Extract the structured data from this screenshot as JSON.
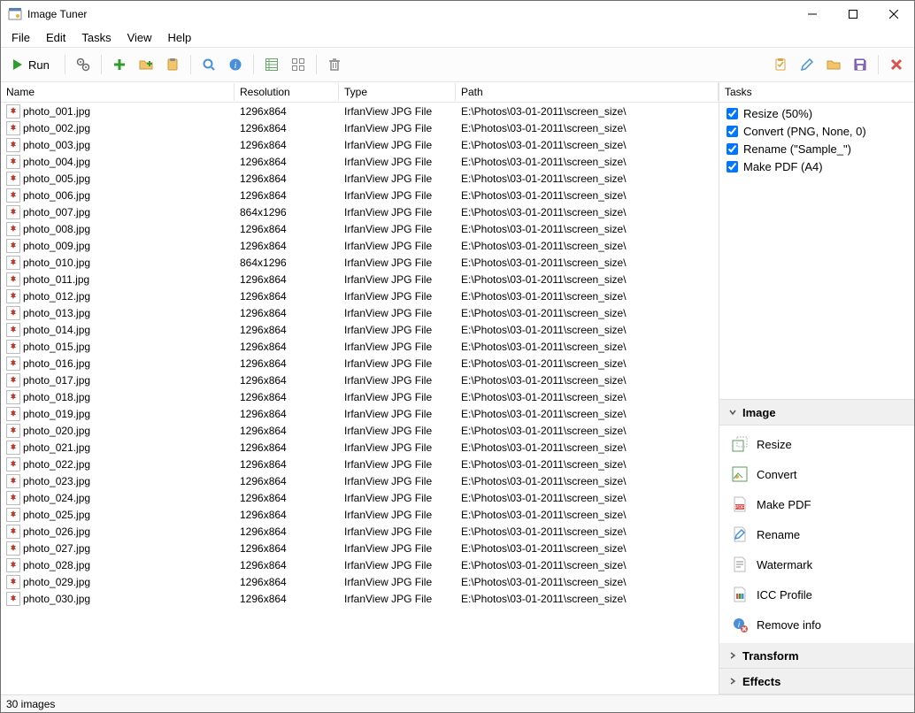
{
  "window": {
    "title": "Image Tuner"
  },
  "menu": [
    "File",
    "Edit",
    "Tasks",
    "View",
    "Help"
  ],
  "toolbar": {
    "run_label": "Run"
  },
  "columns": [
    "Name",
    "Resolution",
    "Type",
    "Path"
  ],
  "files": [
    {
      "name": "photo_001.jpg",
      "resolution": "1296x864",
      "type": "IrfanView JPG File",
      "path": "E:\\Photos\\03-01-2011\\screen_size\\"
    },
    {
      "name": "photo_002.jpg",
      "resolution": "1296x864",
      "type": "IrfanView JPG File",
      "path": "E:\\Photos\\03-01-2011\\screen_size\\"
    },
    {
      "name": "photo_003.jpg",
      "resolution": "1296x864",
      "type": "IrfanView JPG File",
      "path": "E:\\Photos\\03-01-2011\\screen_size\\"
    },
    {
      "name": "photo_004.jpg",
      "resolution": "1296x864",
      "type": "IrfanView JPG File",
      "path": "E:\\Photos\\03-01-2011\\screen_size\\"
    },
    {
      "name": "photo_005.jpg",
      "resolution": "1296x864",
      "type": "IrfanView JPG File",
      "path": "E:\\Photos\\03-01-2011\\screen_size\\"
    },
    {
      "name": "photo_006.jpg",
      "resolution": "1296x864",
      "type": "IrfanView JPG File",
      "path": "E:\\Photos\\03-01-2011\\screen_size\\"
    },
    {
      "name": "photo_007.jpg",
      "resolution": "864x1296",
      "type": "IrfanView JPG File",
      "path": "E:\\Photos\\03-01-2011\\screen_size\\"
    },
    {
      "name": "photo_008.jpg",
      "resolution": "1296x864",
      "type": "IrfanView JPG File",
      "path": "E:\\Photos\\03-01-2011\\screen_size\\"
    },
    {
      "name": "photo_009.jpg",
      "resolution": "1296x864",
      "type": "IrfanView JPG File",
      "path": "E:\\Photos\\03-01-2011\\screen_size\\"
    },
    {
      "name": "photo_010.jpg",
      "resolution": "864x1296",
      "type": "IrfanView JPG File",
      "path": "E:\\Photos\\03-01-2011\\screen_size\\"
    },
    {
      "name": "photo_011.jpg",
      "resolution": "1296x864",
      "type": "IrfanView JPG File",
      "path": "E:\\Photos\\03-01-2011\\screen_size\\"
    },
    {
      "name": "photo_012.jpg",
      "resolution": "1296x864",
      "type": "IrfanView JPG File",
      "path": "E:\\Photos\\03-01-2011\\screen_size\\"
    },
    {
      "name": "photo_013.jpg",
      "resolution": "1296x864",
      "type": "IrfanView JPG File",
      "path": "E:\\Photos\\03-01-2011\\screen_size\\"
    },
    {
      "name": "photo_014.jpg",
      "resolution": "1296x864",
      "type": "IrfanView JPG File",
      "path": "E:\\Photos\\03-01-2011\\screen_size\\"
    },
    {
      "name": "photo_015.jpg",
      "resolution": "1296x864",
      "type": "IrfanView JPG File",
      "path": "E:\\Photos\\03-01-2011\\screen_size\\"
    },
    {
      "name": "photo_016.jpg",
      "resolution": "1296x864",
      "type": "IrfanView JPG File",
      "path": "E:\\Photos\\03-01-2011\\screen_size\\"
    },
    {
      "name": "photo_017.jpg",
      "resolution": "1296x864",
      "type": "IrfanView JPG File",
      "path": "E:\\Photos\\03-01-2011\\screen_size\\"
    },
    {
      "name": "photo_018.jpg",
      "resolution": "1296x864",
      "type": "IrfanView JPG File",
      "path": "E:\\Photos\\03-01-2011\\screen_size\\"
    },
    {
      "name": "photo_019.jpg",
      "resolution": "1296x864",
      "type": "IrfanView JPG File",
      "path": "E:\\Photos\\03-01-2011\\screen_size\\"
    },
    {
      "name": "photo_020.jpg",
      "resolution": "1296x864",
      "type": "IrfanView JPG File",
      "path": "E:\\Photos\\03-01-2011\\screen_size\\"
    },
    {
      "name": "photo_021.jpg",
      "resolution": "1296x864",
      "type": "IrfanView JPG File",
      "path": "E:\\Photos\\03-01-2011\\screen_size\\"
    },
    {
      "name": "photo_022.jpg",
      "resolution": "1296x864",
      "type": "IrfanView JPG File",
      "path": "E:\\Photos\\03-01-2011\\screen_size\\"
    },
    {
      "name": "photo_023.jpg",
      "resolution": "1296x864",
      "type": "IrfanView JPG File",
      "path": "E:\\Photos\\03-01-2011\\screen_size\\"
    },
    {
      "name": "photo_024.jpg",
      "resolution": "1296x864",
      "type": "IrfanView JPG File",
      "path": "E:\\Photos\\03-01-2011\\screen_size\\"
    },
    {
      "name": "photo_025.jpg",
      "resolution": "1296x864",
      "type": "IrfanView JPG File",
      "path": "E:\\Photos\\03-01-2011\\screen_size\\"
    },
    {
      "name": "photo_026.jpg",
      "resolution": "1296x864",
      "type": "IrfanView JPG File",
      "path": "E:\\Photos\\03-01-2011\\screen_size\\"
    },
    {
      "name": "photo_027.jpg",
      "resolution": "1296x864",
      "type": "IrfanView JPG File",
      "path": "E:\\Photos\\03-01-2011\\screen_size\\"
    },
    {
      "name": "photo_028.jpg",
      "resolution": "1296x864",
      "type": "IrfanView JPG File",
      "path": "E:\\Photos\\03-01-2011\\screen_size\\"
    },
    {
      "name": "photo_029.jpg",
      "resolution": "1296x864",
      "type": "IrfanView JPG File",
      "path": "E:\\Photos\\03-01-2011\\screen_size\\"
    },
    {
      "name": "photo_030.jpg",
      "resolution": "1296x864",
      "type": "IrfanView JPG File",
      "path": "E:\\Photos\\03-01-2011\\screen_size\\"
    }
  ],
  "tasks": {
    "header": "Tasks",
    "items": [
      {
        "label": "Resize (50%)",
        "checked": true
      },
      {
        "label": "Convert (PNG, None, 0)",
        "checked": true
      },
      {
        "label": "Rename (\"Sample_\")",
        "checked": true
      },
      {
        "label": "Make PDF (A4)",
        "checked": true
      }
    ]
  },
  "accordion": {
    "image": {
      "title": "Image",
      "actions": [
        {
          "icon": "resize-icon",
          "label": "Resize"
        },
        {
          "icon": "convert-icon",
          "label": "Convert"
        },
        {
          "icon": "pdf-icon",
          "label": "Make PDF"
        },
        {
          "icon": "rename-icon",
          "label": "Rename"
        },
        {
          "icon": "watermark-icon",
          "label": "Watermark"
        },
        {
          "icon": "icc-icon",
          "label": "ICC Profile"
        },
        {
          "icon": "removeinfo-icon",
          "label": "Remove info"
        }
      ]
    },
    "transform": {
      "title": "Transform"
    },
    "effects": {
      "title": "Effects"
    }
  },
  "status": {
    "text": "30 images"
  },
  "colors": {
    "accent_green": "#2e9e2e",
    "accent_blue": "#4a90d9",
    "accent_red": "#d9534f",
    "folder": "#f3c46b",
    "purple": "#8e6bc4"
  }
}
